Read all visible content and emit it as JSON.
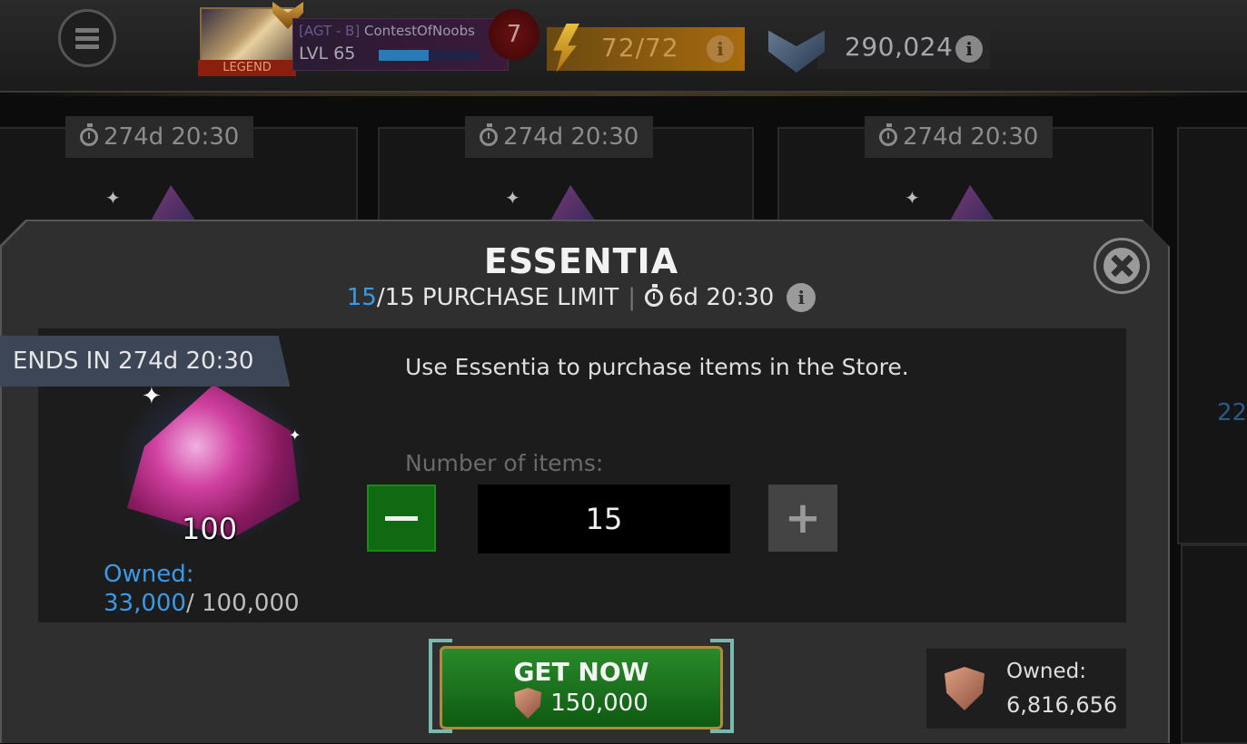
{
  "topbar": {
    "alliance_tag": "[AGT - B]",
    "player_name": "ContestOfNoobs",
    "level": "LVL 65",
    "rank_tag": "LEGEND",
    "notifications": "7",
    "energy": "72/72",
    "gold": "290,024",
    "info_glyph": "i"
  },
  "store_cards": {
    "timer": "274d 20:30",
    "partial_value": "22"
  },
  "modal": {
    "title": "ESSENTIA",
    "purchased": "15",
    "limit_rest": "/15 PURCHASE LIMIT",
    "separator": "|",
    "reset_timer": "6d 20:30",
    "ends_banner": "ENDS IN 274d 20:30",
    "item_quantity": "100",
    "owned_label": "Owned:",
    "owned_current": "33,000",
    "owned_max": "/ 100,000",
    "description": "Use Essentia to purchase items in the Store.",
    "number_label": "Number of items:",
    "number_value": "15",
    "plus_glyph": "+",
    "get_now_label": "GET NOW",
    "price": "150,000",
    "currency_owned_label": "Owned:",
    "currency_owned_value": "6,816,656"
  },
  "colors": {
    "accent_blue": "#3a9ae8",
    "button_green": "#0f6a12",
    "panel_dark": "#1c1c1d"
  },
  "icons": [
    "menu-icon",
    "lightning-bolt-icon",
    "gold-chevron-icon",
    "info-icon",
    "stopwatch-icon",
    "close-icon",
    "minus-icon",
    "plus-icon",
    "battlechip-shield-icon",
    "sparkle-icon"
  ]
}
